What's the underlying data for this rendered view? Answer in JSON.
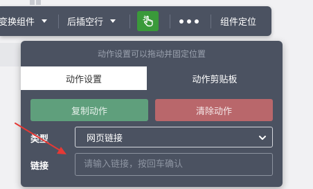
{
  "toolbar": {
    "swap_component": "变换组件",
    "insert_after": "后插空行",
    "locate_component": "组件定位"
  },
  "panel": {
    "drag_hint": "动作设置可以拖动并固定位置",
    "tabs": [
      "动作设置",
      "动作剪贴板"
    ],
    "copy_action": "复制动作",
    "clear_action": "清除动作",
    "type_label": "类型",
    "type_value": "网页链接",
    "link_label": "链接",
    "link_placeholder": "请输入链接，按回车确认"
  },
  "colors": {
    "toolbar_bg": "#4b5261",
    "green_button": "#3a9a3a",
    "copy_button": "#5f9f7c",
    "clear_button": "#b9676b",
    "annotation_arrow": "#e53935"
  }
}
